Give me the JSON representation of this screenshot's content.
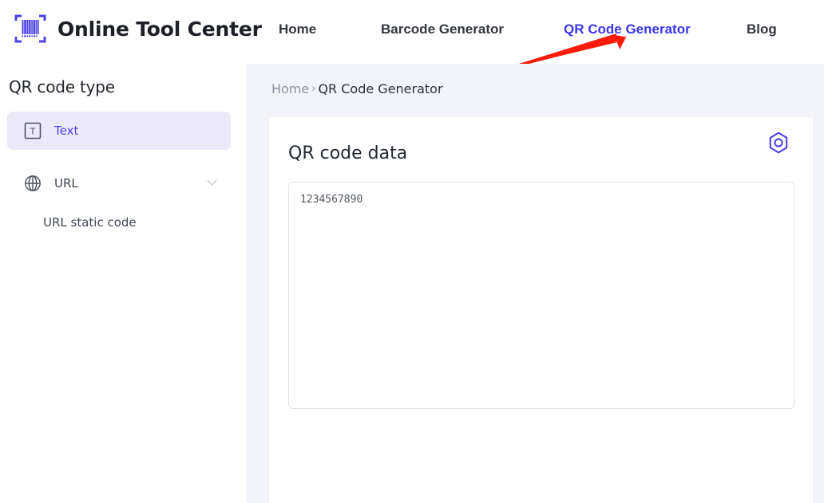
{
  "brand": {
    "name": "Online Tool Center",
    "logo_icon": "barcode-scan-icon",
    "logo_color": "#4b44e8"
  },
  "nav": {
    "items": [
      {
        "label": "Home",
        "active": false
      },
      {
        "label": "Barcode Generator",
        "active": false
      },
      {
        "label": "QR Code Generator",
        "active": true
      },
      {
        "label": "Blog",
        "active": false
      }
    ],
    "active_color": "#3a35f0",
    "inactive_color": "#33373d"
  },
  "annotation": {
    "type": "red-arrow",
    "color": "#fb1b08",
    "points_to": "QR Code Generator"
  },
  "sidebar": {
    "title": "QR code type",
    "items": [
      {
        "label": "Text",
        "icon": "text-box-icon",
        "selected": true,
        "expandable": false
      },
      {
        "label": "URL",
        "icon": "globe-icon",
        "selected": false,
        "expandable": true,
        "chevron": "chevron-down-icon"
      }
    ],
    "sub_items": [
      {
        "label": "URL static code"
      }
    ],
    "selected_bg": "#eceafa",
    "selected_text_color": "#4b44e8"
  },
  "breadcrumb": {
    "home": "Home",
    "separator": "›",
    "current": "QR Code Generator"
  },
  "card": {
    "title": "QR code data",
    "settings_icon": "hexagon-target-icon",
    "settings_icon_color": "#4b44e8",
    "textarea": {
      "value": "1234567890",
      "placeholder": ""
    }
  }
}
